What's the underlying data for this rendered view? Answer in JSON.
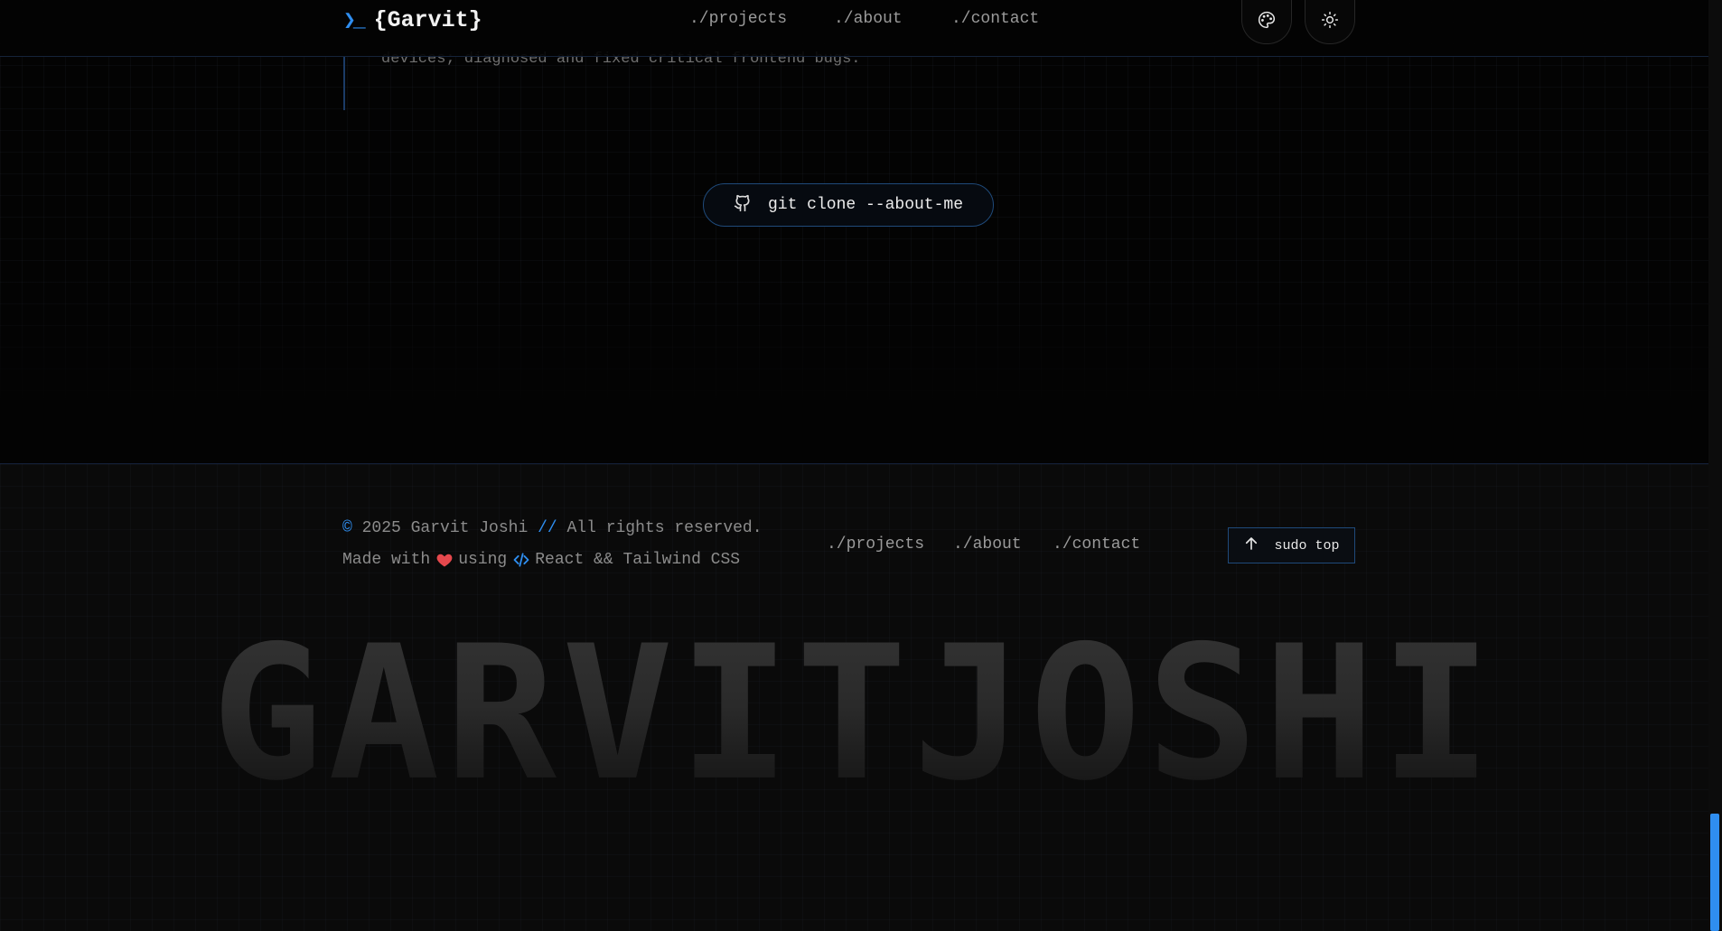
{
  "header": {
    "logo_icon": "❯_",
    "logo_text": "{Garvit}",
    "nav": [
      "./projects",
      "./about",
      "./contact"
    ],
    "palette_button": "palette-icon",
    "theme_button": "sun-icon"
  },
  "main": {
    "experience_text": "devices; diagnosed and fixed critical frontend bugs.",
    "clone_button_label": "git clone --about-me",
    "clone_button_icon": "github-icon"
  },
  "footer": {
    "copyright_symbol": "©",
    "copyright_text": "2025 Garvit Joshi",
    "copyright_sep": "//",
    "rights_text": "All rights reserved.",
    "made_with": "Made with",
    "using": "using",
    "tech": "React && Tailwind CSS",
    "nav": [
      "./projects",
      "./about",
      "./contact"
    ],
    "sudo_label": "sudo top",
    "big_name": "GARVITJOSHI"
  },
  "colors": {
    "accent": "#2f8ef0",
    "heart": "#e5484d",
    "background": "#030303"
  }
}
